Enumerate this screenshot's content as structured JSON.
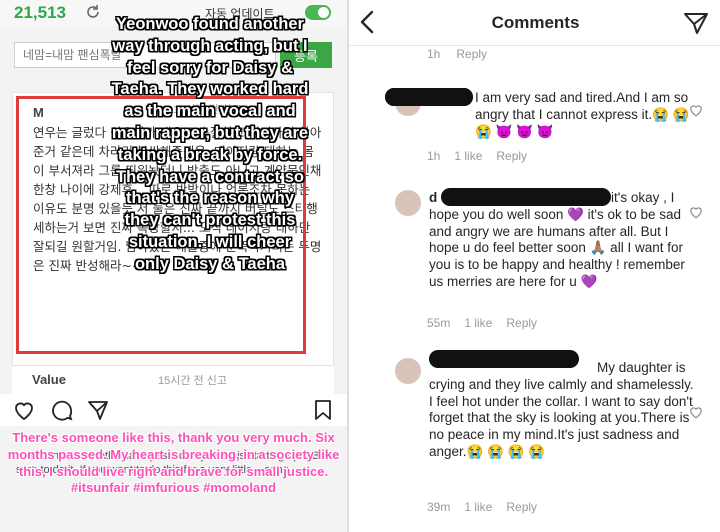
{
  "left": {
    "status": {
      "count": "21,513",
      "auto_update": "자동 업데이트"
    },
    "nick_placeholder": "네맘=내맘 팬심폭발 ",
    "submit_label": "등록",
    "comment1": {
      "author": "M",
      "meta": "14시간 전   신고",
      "body": "연우는 글렀다 싶으니까 배우로 손절하고 연기자길 찾아준거 같은데 차라리 불쌍해죽겠음. 데이지랑 태하는 몸이 부서져라 그룹 띄워놨더니 방출도 아니고 계약묶인채 한창 나이에 강제휴... 따로 반박이나 언론조차 못하는 이유도 분명 있을듯 저 둘은 진짜 끝까지 버틸도 스타행세하는거 보면 진짜 속상할지... 오직 데이지랑 태하만 잘되길 원할거임. 남아있는 애들중에 춘뚝딱거리는 두명은 진짜 반성해라~~~"
    },
    "comment2": {
      "author": "Value",
      "meta": "15시간 전   신고"
    },
    "bottom_text": "Wer... time, 6 months have passed. My heart is starting up... Be sure to do it. If you want to do this for a very little... eong ..."
  },
  "overlay_text": "Yeonwoo found another way through acting, but I feel sorry for Daisy & Taeha. They worked hard as the main vocal and main rapper, but they are taking a break by force. They have a contract so that's the reason why they can't protest this situation. I will cheer only Daisy & Taeha",
  "pink_text": "There's someone like this, thank you very much. Six months passed. My heart is breaking, in a society like this, I should live right and brave for small justice. #itsunfair #imfurious #momoland",
  "right": {
    "title": "Comments",
    "pre_meta": {
      "time": "1h",
      "reply": "Reply"
    },
    "comments": [
      {
        "author": "",
        "text": "I am very sad and tired.And I am so angry that I cannot express it.😭 😭 😭 👿 👿 👿",
        "time": "1h",
        "likes": "1 like",
        "reply": "Reply"
      },
      {
        "author": "d",
        "text": "it's okay , I hope you do well soon 💜 it's ok to be sad and angry we are humans after all. But I hope u do feel better soon 🙏🏽 all I want for you is to be happy and healthy ! remember us merries are here for u 💜",
        "time": "55m",
        "likes": "1 like",
        "reply": "Reply"
      },
      {
        "author": "",
        "text": "My daughter is crying and they live calmly and shamelessly. I feel hot under the collar. I want to say don't forget that the sky is looking at you.There is no peace in my mind.It's just sadness and anger.😭 😭 😭 😭",
        "time": "39m",
        "likes": "1 like",
        "reply": "Reply"
      }
    ]
  }
}
